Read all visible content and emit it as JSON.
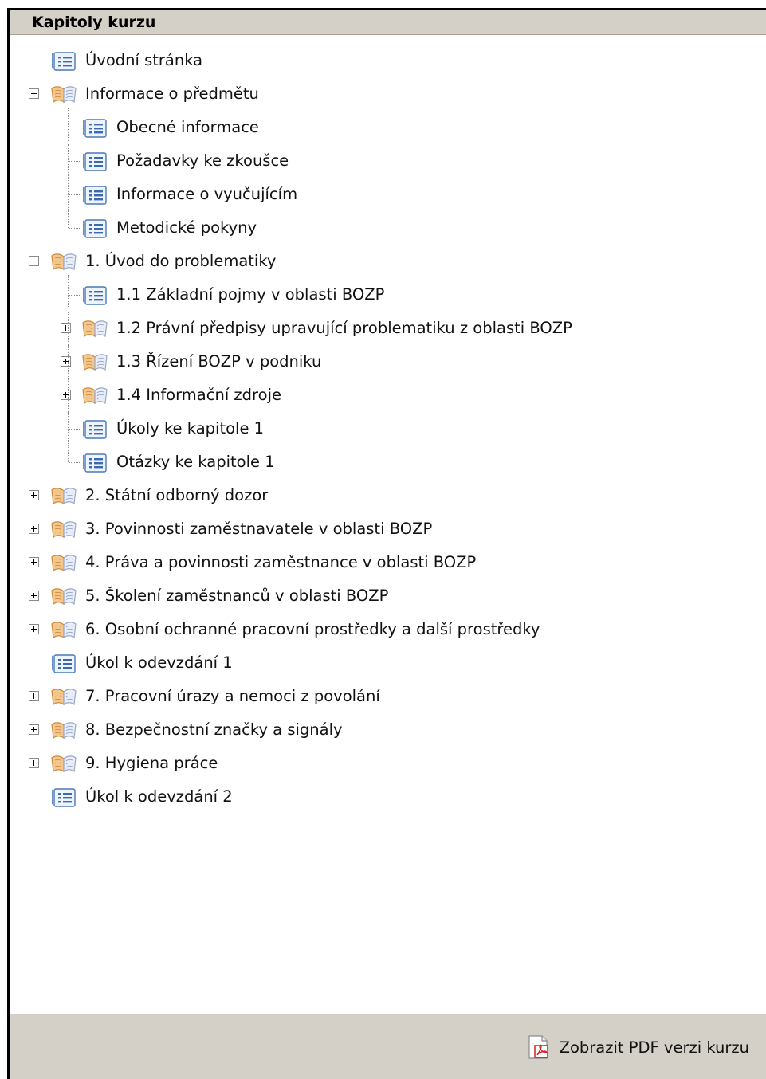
{
  "panel": {
    "title": "Kapitoly kurzu"
  },
  "tree": [
    {
      "label": "Úvodní stránka",
      "type": "page",
      "level": 0
    },
    {
      "label": "Informace o předmětu",
      "type": "book",
      "level": 0,
      "toggle": "minus"
    },
    {
      "label": "Obecné informace",
      "type": "page",
      "level": 1
    },
    {
      "label": "Požadavky ke zkoušce",
      "type": "page",
      "level": 1
    },
    {
      "label": "Informace o vyučujícím",
      "type": "page",
      "level": 1
    },
    {
      "label": "Metodické pokyny",
      "type": "page",
      "level": 1
    },
    {
      "label": "1. Úvod do problematiky",
      "type": "book",
      "level": 0,
      "toggle": "minus"
    },
    {
      "label": "1.1 Základní pojmy v oblasti BOZP",
      "type": "page",
      "level": 1
    },
    {
      "label": "1.2 Právní předpisy upravující problematiku z oblasti BOZP",
      "type": "book",
      "level": 1,
      "toggle": "plus"
    },
    {
      "label": "1.3 Řízení BOZP v podniku",
      "type": "book",
      "level": 1,
      "toggle": "plus"
    },
    {
      "label": "1.4 Informační zdroje",
      "type": "book",
      "level": 1,
      "toggle": "plus"
    },
    {
      "label": "Úkoly ke kapitole 1",
      "type": "page",
      "level": 1
    },
    {
      "label": "Otázky ke kapitole 1",
      "type": "page",
      "level": 1
    },
    {
      "label": "2. Státní odborný dozor",
      "type": "book",
      "level": 0,
      "toggle": "plus"
    },
    {
      "label": "3. Povinnosti zaměstnavatele v oblasti BOZP",
      "type": "book",
      "level": 0,
      "toggle": "plus"
    },
    {
      "label": "4. Práva a povinnosti zaměstnance v oblasti BOZP",
      "type": "book",
      "level": 0,
      "toggle": "plus"
    },
    {
      "label": "5. Školení zaměstnanců v oblasti BOZP",
      "type": "book",
      "level": 0,
      "toggle": "plus"
    },
    {
      "label": "6. Osobní ochranné pracovní prostředky a další prostředky",
      "type": "book",
      "level": 0,
      "toggle": "plus"
    },
    {
      "label": "Úkol k odevzdání 1",
      "type": "page",
      "level": 0
    },
    {
      "label": "7. Pracovní úrazy a nemoci z povolání",
      "type": "book",
      "level": 0,
      "toggle": "plus"
    },
    {
      "label": "8. Bezpečnostní značky a signály",
      "type": "book",
      "level": 0,
      "toggle": "plus"
    },
    {
      "label": "9. Hygiena práce",
      "type": "book",
      "level": 0,
      "toggle": "plus"
    },
    {
      "label": "Úkol k odevzdání 2",
      "type": "page",
      "level": 0
    }
  ],
  "footer": {
    "pdf_label": "Zobrazit PDF verzi kurzu"
  },
  "icons": {
    "page": "document-list-icon",
    "book": "open-book-icon",
    "pdf": "pdf-icon"
  }
}
